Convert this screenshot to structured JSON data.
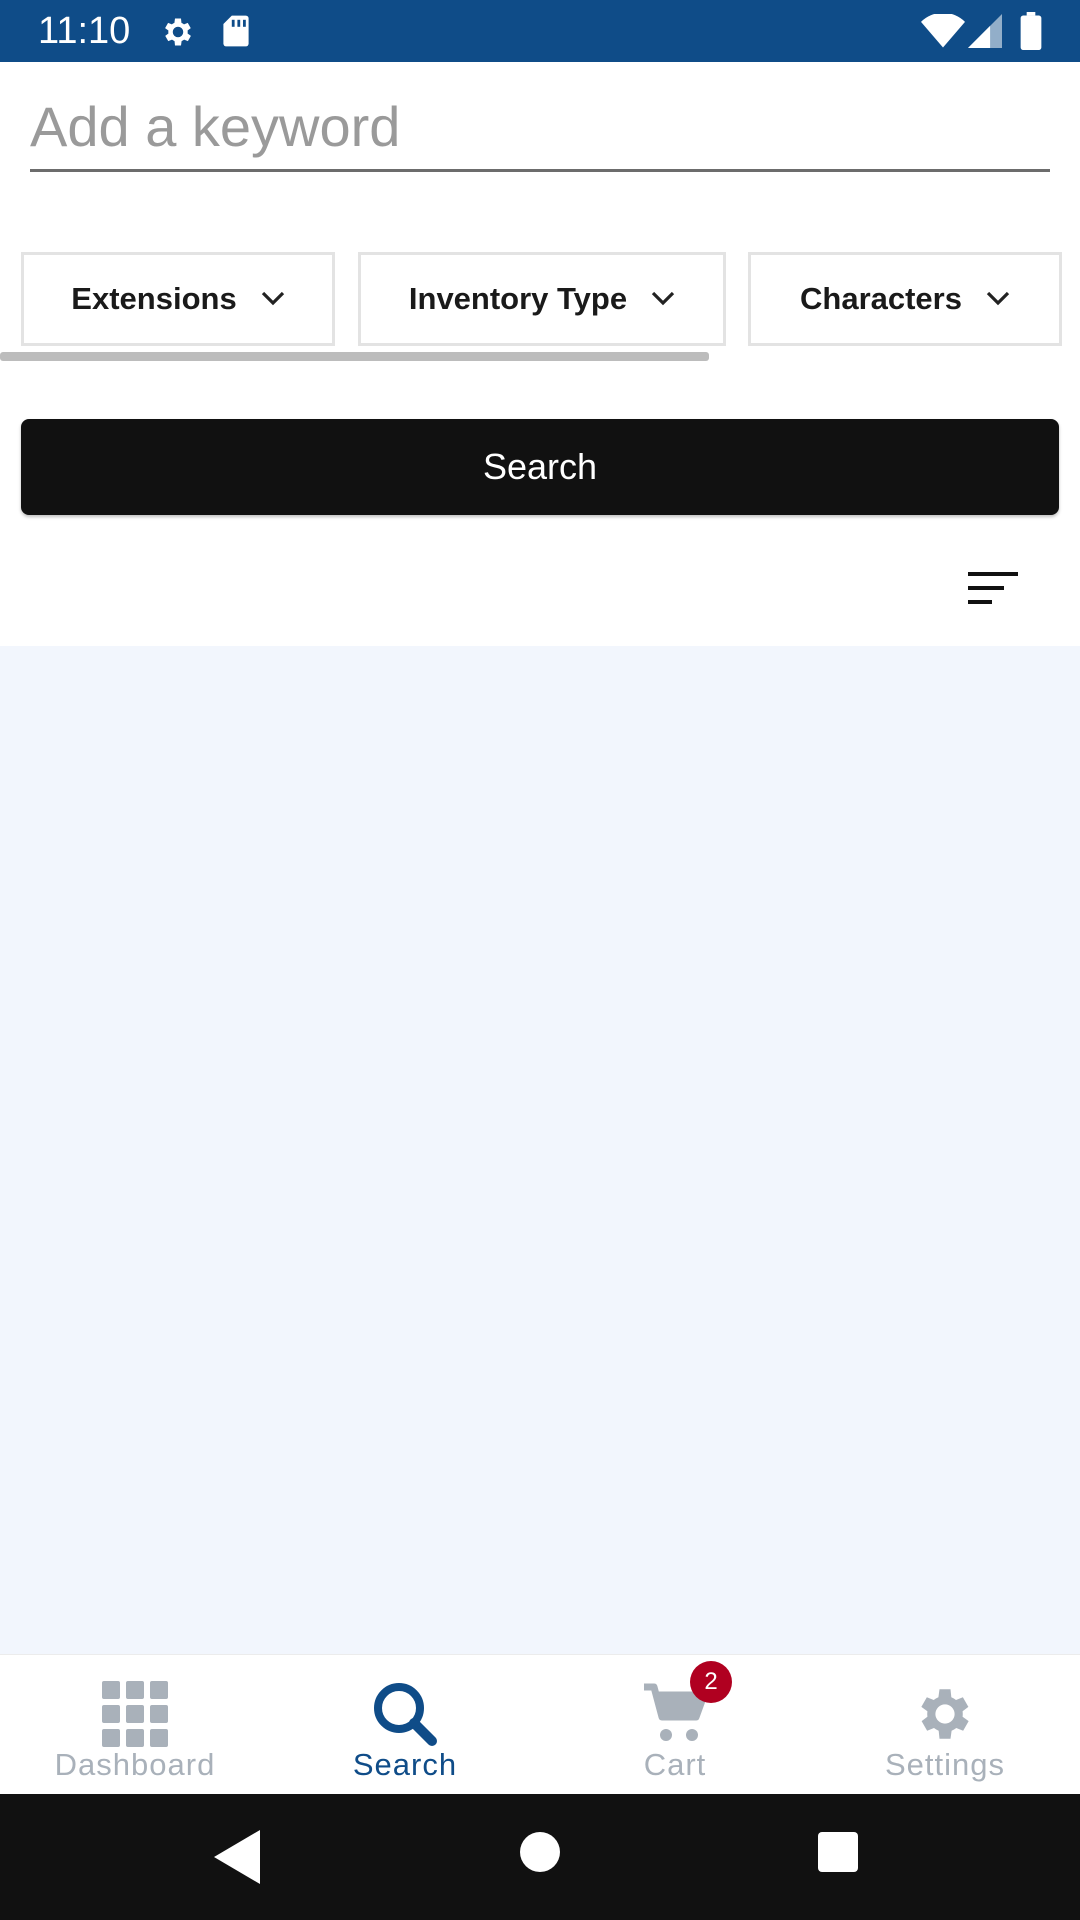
{
  "colors": {
    "status_bar": "#0f4c88",
    "accent": "#0f4c88",
    "inactive": "#a9b1ba",
    "badge": "#b00020",
    "results_bg": "#f2f6fd"
  },
  "status_bar": {
    "time": "11:10",
    "icons": [
      "gear-icon",
      "sd-card-icon",
      "wifi-icon",
      "signal-icon",
      "battery-icon"
    ]
  },
  "search": {
    "keyword_value": "",
    "keyword_placeholder": "Add a keyword",
    "button_label": "Search"
  },
  "filters": [
    {
      "label": "Extensions",
      "icon": "chevron-down-icon"
    },
    {
      "label": "Inventory Type",
      "icon": "chevron-down-icon"
    },
    {
      "label": "Characters",
      "icon": "chevron-down-icon"
    }
  ],
  "sort": {
    "icon": "sort-icon"
  },
  "bottom_nav": {
    "items": [
      {
        "label": "Dashboard",
        "icon": "grid-icon",
        "active": false
      },
      {
        "label": "Search",
        "icon": "search-icon",
        "active": true
      },
      {
        "label": "Cart",
        "icon": "cart-icon",
        "active": false,
        "badge": "2"
      },
      {
        "label": "Settings",
        "icon": "gear-icon",
        "active": false
      }
    ]
  }
}
